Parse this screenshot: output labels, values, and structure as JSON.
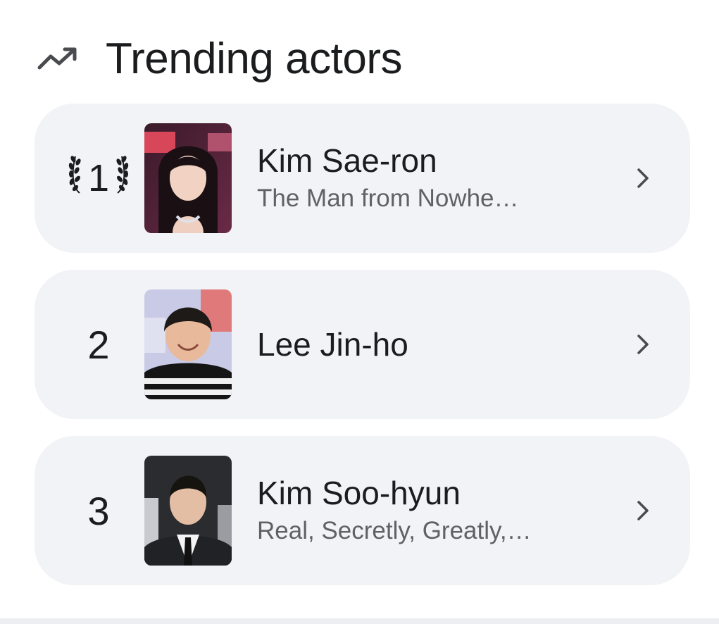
{
  "header": {
    "icon": "trending-up-icon",
    "title": "Trending actors"
  },
  "actors": [
    {
      "rank": "1",
      "rank_style": "laurel",
      "name": "Kim Sae-ron",
      "subtitle": "The Man from Nowhe…",
      "photo": "actor-photo",
      "chevron": "chevron-right-icon"
    },
    {
      "rank": "2",
      "rank_style": "plain",
      "name": "Lee Jin-ho",
      "subtitle": "",
      "photo": "actor-photo",
      "chevron": "chevron-right-icon"
    },
    {
      "rank": "3",
      "rank_style": "plain",
      "name": "Kim Soo-hyun",
      "subtitle": "Real, Secretly, Greatly,…",
      "photo": "actor-photo",
      "chevron": "chevron-right-icon"
    }
  ],
  "colors": {
    "card_bg": "#f2f3f6",
    "title_text": "#1b1c1e",
    "subtitle_text": "#5f6166"
  }
}
